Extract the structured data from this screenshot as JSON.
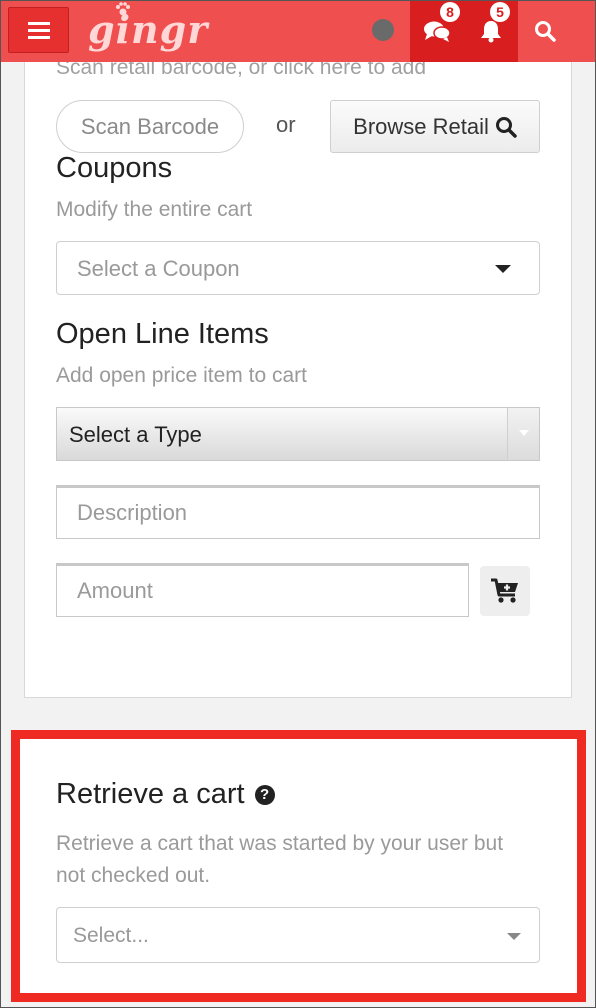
{
  "header": {
    "logo_text": "gingr",
    "chat_badge": "8",
    "notifications_badge": "5",
    "colors": {
      "bar": "#ef4f4f",
      "icon_block": "#d81e1e"
    }
  },
  "retail": {
    "hint": "Scan retail barcode, or click here to add",
    "scan_button": "Scan Barcode",
    "or_label": "or",
    "browse_button": "Browse Retail"
  },
  "coupons": {
    "title": "Coupons",
    "subtitle": "Modify the entire cart",
    "select_placeholder": "Select a Coupon"
  },
  "open_line_items": {
    "title": "Open Line Items",
    "subtitle": "Add open price item to cart",
    "type_select": "Select a Type",
    "description_placeholder": "Description",
    "amount_placeholder": "Amount"
  },
  "retrieve_cart": {
    "title": "Retrieve a cart",
    "description": "Retrieve a cart that was started by your user but not checked out.",
    "select_placeholder": "Select..."
  },
  "icons": [
    "menu-icon",
    "paw-icon",
    "chat-icon",
    "bell-icon",
    "search-icon",
    "cart-plus-icon",
    "help-icon",
    "caret-down-icon"
  ]
}
